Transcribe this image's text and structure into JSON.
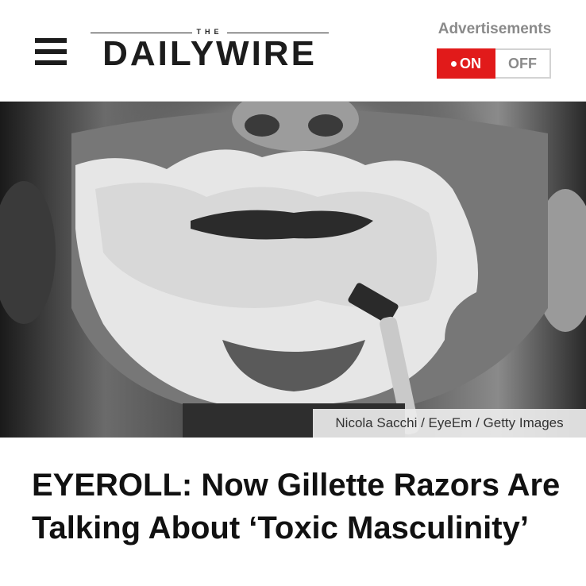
{
  "header": {
    "menu_icon": "hamburger-menu-icon",
    "logo_top": "THE",
    "logo_word": "DAILYWIRE"
  },
  "ads": {
    "label": "Advertisements",
    "on_label": "ON",
    "off_label": "OFF",
    "state": "on",
    "accent_color": "#e11a1a"
  },
  "hero": {
    "credit": "Nicola Sacchi / EyeEm / Getty Images"
  },
  "article": {
    "headline": "EYEROLL: Now Gillette Razors Are Talking About ‘Toxic Masculinity’"
  }
}
